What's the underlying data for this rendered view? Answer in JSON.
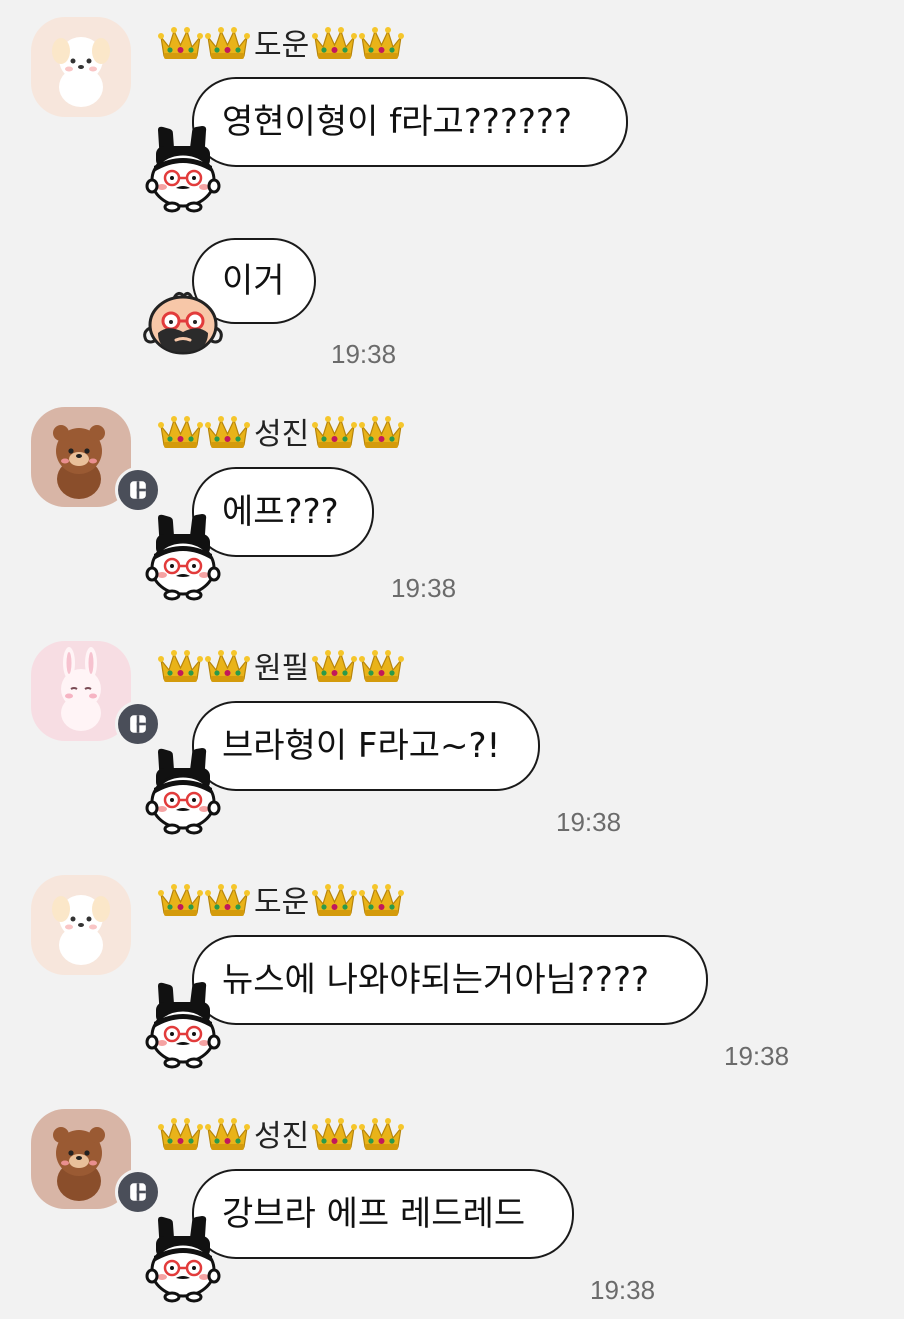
{
  "messages": [
    {
      "sender": "도운",
      "text": "영현이형이 f라고??????",
      "time": "",
      "avatar": "white-puppy-avatar",
      "badge": false,
      "sticker": "bunny-mascot-sticker"
    },
    {
      "sender": "",
      "text": "이거",
      "time": "19:38",
      "avatar": "",
      "badge": false,
      "sticker": "mustache-face-sticker"
    },
    {
      "sender": "성진",
      "text": "에프???",
      "time": "19:38",
      "avatar": "brown-bear-avatar",
      "badge": true,
      "sticker": "bunny-mascot-sticker"
    },
    {
      "sender": "원필",
      "text": "브라형이 F라고~?!",
      "time": "19:38",
      "avatar": "pink-bunny-avatar",
      "badge": true,
      "sticker": "bunny-mascot-sticker"
    },
    {
      "sender": "도운",
      "text": "뉴스에 나와야되는거아님????",
      "time": "19:38",
      "avatar": "white-puppy-avatar",
      "badge": false,
      "sticker": "bunny-mascot-sticker"
    },
    {
      "sender": "성진",
      "text": "강브라 에프 레드레드",
      "time": "19:38",
      "avatar": "brown-bear-avatar",
      "badge": true,
      "sticker": "bunny-mascot-sticker"
    }
  ],
  "colors": {
    "background": "#f2f2f2",
    "bubble": "#ffffff",
    "bubble_border": "#1a1a1a",
    "time": "#6b6b6b",
    "badge": "#4a4e59",
    "crown_gold": "#e9b319"
  }
}
